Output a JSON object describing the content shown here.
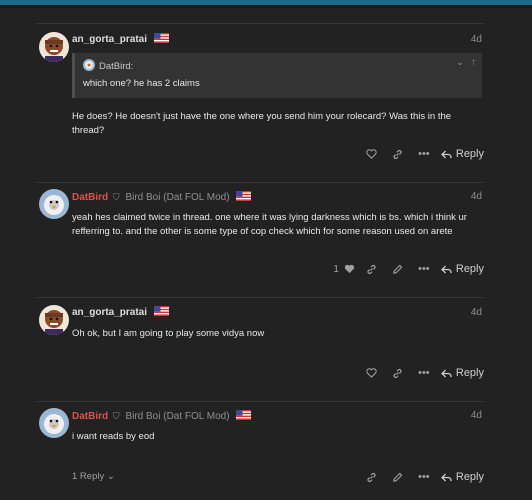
{
  "colors": {
    "accent_bar": "#1c6a87",
    "mod_name": "#e05050",
    "background": "#222222"
  },
  "posts": [
    {
      "username": "an_gorta_pratai",
      "date": "4d",
      "quote": {
        "author": "DatBird:",
        "text": "which one? he has 2 claims"
      },
      "body": "He does? He doesn't just have the one where you send him your rolecard? Was this in the thread?",
      "reply_label": "Reply"
    },
    {
      "username": "DatBird",
      "user_title": "Bird Boi (Dat FOL Mod)",
      "date": "4d",
      "body": "yeah hes claimed twice in thread. one where it was lying darkness which is bs. which i think ur refferring to. and the other is some type of cop check which for some reason used on arete",
      "likes": "1",
      "reply_label": "Reply"
    },
    {
      "username": "an_gorta_pratai",
      "date": "4d",
      "body": "Oh ok, but I am going to play some vidya now",
      "reply_label": "Reply"
    },
    {
      "username": "DatBird",
      "user_title": "Bird Boi (Dat FOL Mod)",
      "date": "4d",
      "body": "i want reads by eod",
      "replies_toggle": "1 Reply",
      "reply_label": "Reply"
    }
  ],
  "icons": [
    "heart-icon",
    "link-icon",
    "pencil-icon",
    "more-icon",
    "reply-icon",
    "shield-icon",
    "flag-icon",
    "chevron-down-icon",
    "arrow-up-icon"
  ]
}
